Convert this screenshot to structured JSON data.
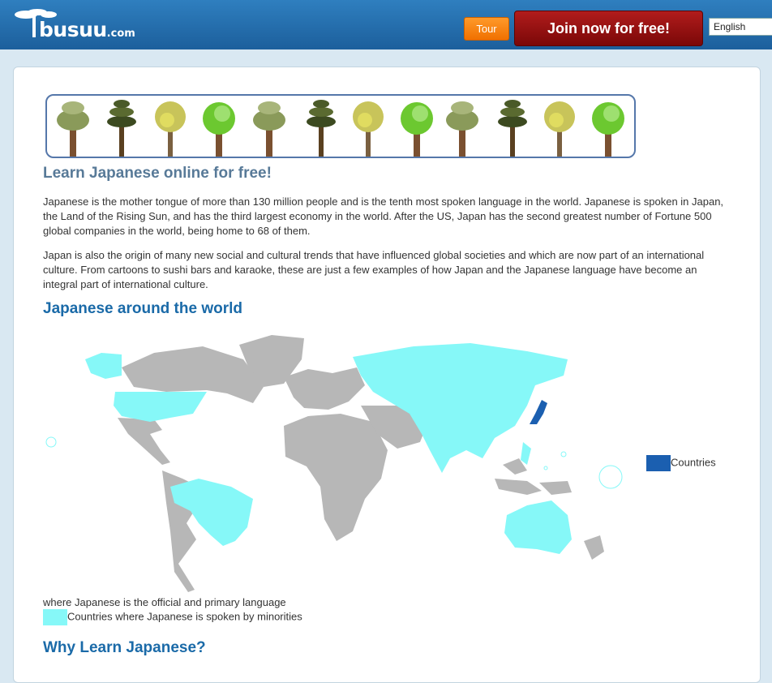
{
  "header": {
    "logo_text": "busuu",
    "logo_suffix": ".com",
    "tour_label": "Tour",
    "join_label": "Join now for free!",
    "language_selected": "English"
  },
  "main": {
    "title": "Learn Japanese online for free!",
    "paragraph1": "Japanese is the mother tongue of more than 130 million people and is the tenth most spoken language in the world. Japanese is spoken in Japan, the Land of the Rising Sun, and has the third largest economy in the world. After the US, Japan has the second greatest number of Fortune 500 global companies in the world, being home to 68 of them.",
    "paragraph2": "Japan is also the origin of many new social and cultural trends that have influenced global societies and which are now part of an international culture. From cartoons to sushi bars and karaoke, these are just a few examples of how Japan and the Japanese language have become an integral part of international culture.",
    "section_world": "Japanese around the world",
    "section_why": "Why Learn Japanese?"
  },
  "map": {
    "legend_official_a": "Countries",
    "legend_official_b": "where Japanese is the official and primary language",
    "legend_minority": "Countries where Japanese is spoken by minorities"
  },
  "colors": {
    "official": "#1b5fb0",
    "minority": "#86f8f8",
    "other": "#b7b7b7",
    "heading": "#1a6aa8"
  }
}
